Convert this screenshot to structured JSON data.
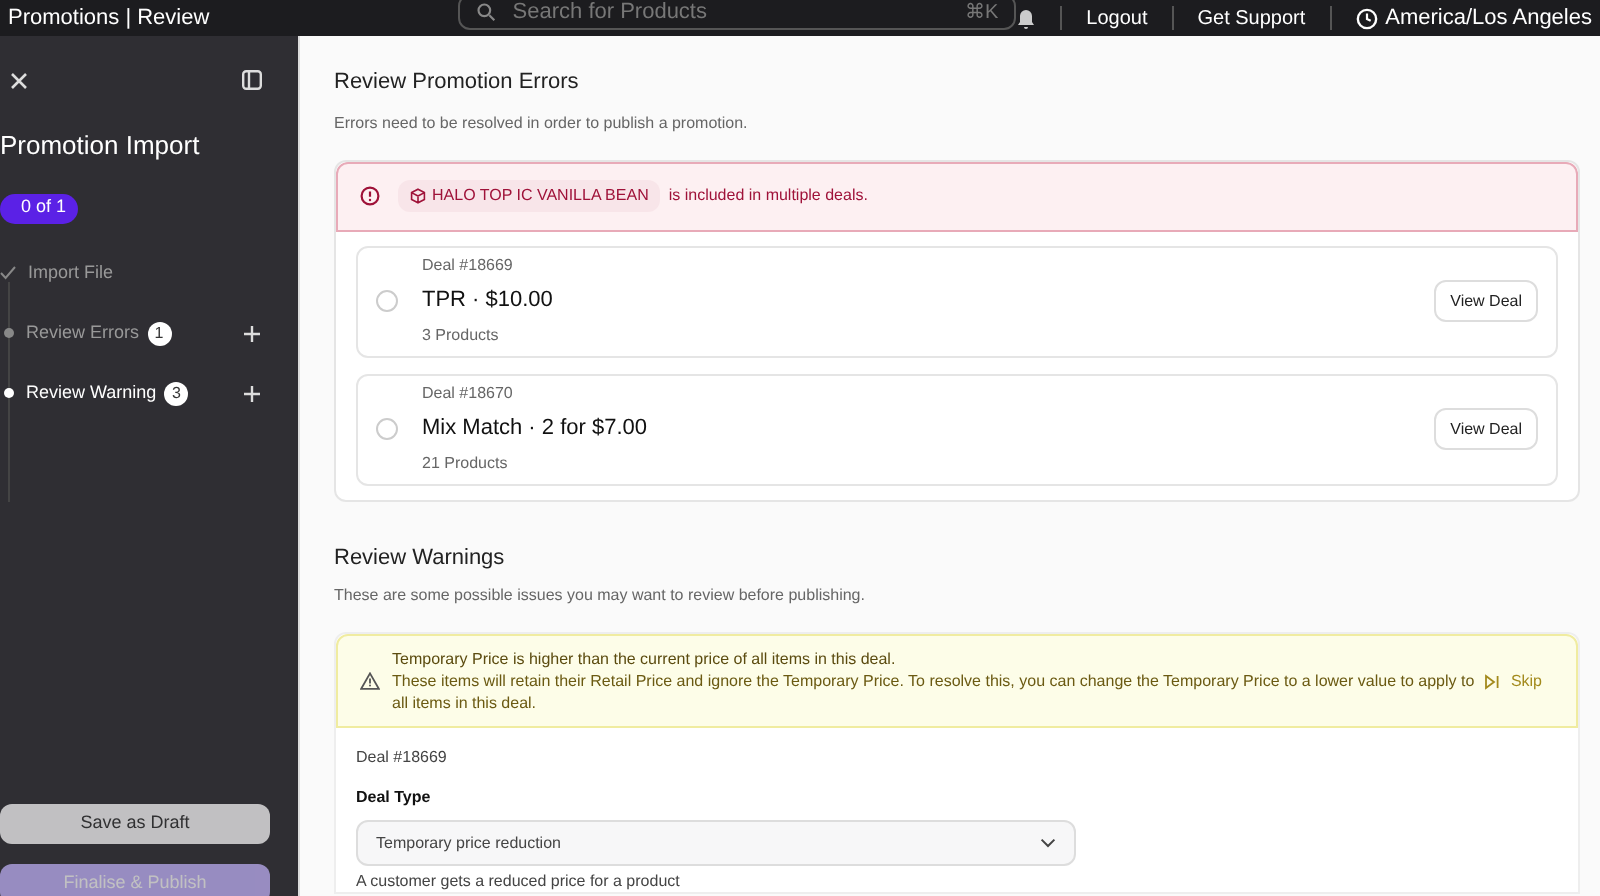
{
  "top_bar": {
    "title": "Promotions | Review",
    "search": {
      "placeholder": "Search for Products",
      "shortcut": "⌘K"
    },
    "links": [
      "Logout",
      "Get Support"
    ],
    "timezone": "America/Los Angeles"
  },
  "sidebar": {
    "title": "Promotion Import",
    "progress": "0 of 1",
    "steps": [
      {
        "label": "Import File",
        "completed": true,
        "selected": false
      },
      {
        "label": "Review Errors",
        "completed": false,
        "selected": false,
        "count": "1"
      },
      {
        "label": "Review Warning",
        "completed": false,
        "selected": true,
        "count": "3"
      }
    ],
    "buttons": [
      {
        "label": "Save as Draft",
        "kind": "secondary",
        "disabled": true
      },
      {
        "label": "Finalise & Publish",
        "kind": "primary",
        "disabled": true
      }
    ]
  },
  "errors": {
    "title": "Review Promotion Errors",
    "subtitle": "Errors need to be resolved in order to publish a promotion.",
    "alert": {
      "product": "HALO TOP IC VANILLA BEAN",
      "message": "is included in multiple deals."
    },
    "deals": [
      {
        "number": "Deal #18669",
        "name": "TPR · $10.00",
        "products": "3 Products",
        "selected": false,
        "button": "View Deal"
      },
      {
        "number": "Deal #18670",
        "name": "Mix Match · 2 for $7.00",
        "products": "21 Products",
        "selected": false,
        "button": "View Deal"
      }
    ]
  },
  "warnings": {
    "title": "Review Warnings",
    "subtitle": "These are some possible issues you may want to review before publishing.",
    "alert": {
      "heading": "Temporary Price is higher than the current price of all items in this deal.",
      "message": "These items will retain their Retail Price and ignore the Temporary Price. To resolve this, you can change the Temporary Price to a lower value to apply to all items in this deal.",
      "action": "Skip"
    },
    "deal": {
      "number": "Deal #18669",
      "field_label": "Deal Type",
      "value": "Temporary price reduction",
      "help": "A customer gets a reduced price for a product"
    }
  }
}
